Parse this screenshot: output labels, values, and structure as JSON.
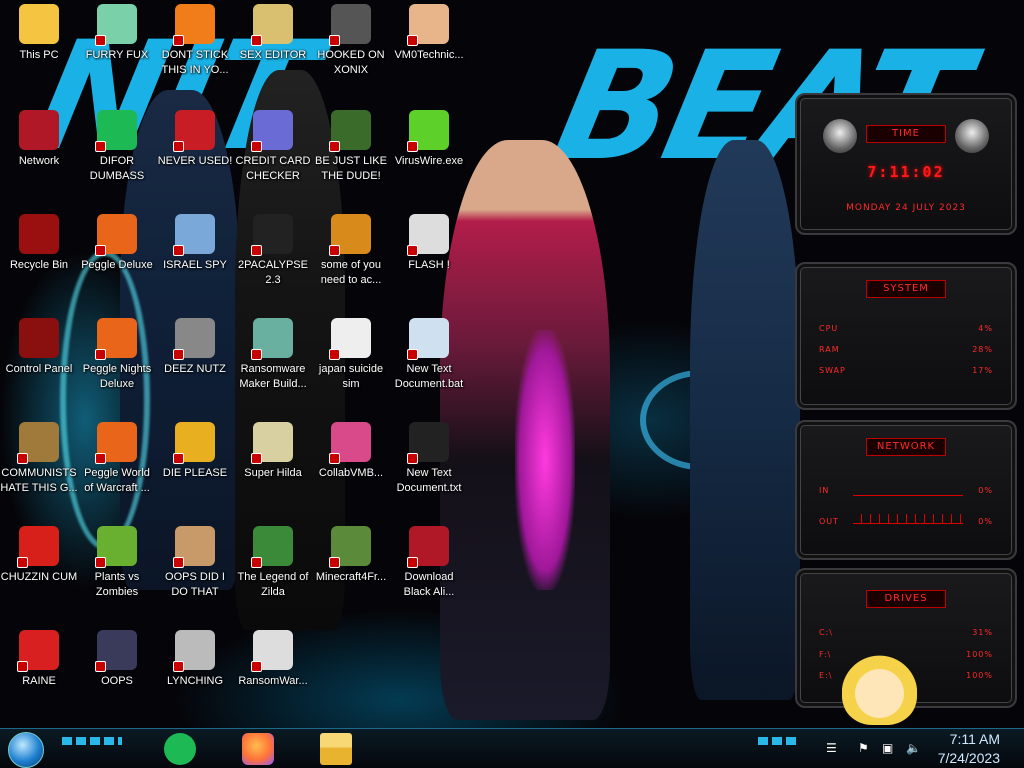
{
  "icons": [
    {
      "label": "This PC",
      "color": "#f5c542"
    },
    {
      "label": "FURRY FUX",
      "color": "#7ad0a8"
    },
    {
      "label": "DONT STICK THIS IN YO...",
      "color": "#f07d1a"
    },
    {
      "label": "SEX EDITOR",
      "color": "#d8c070"
    },
    {
      "label": "HOOKED ON XONIX",
      "color": "#555"
    },
    {
      "label": "VM0Technic...",
      "color": "#e8b48a"
    },
    {
      "label": "Network",
      "color": "#b01828"
    },
    {
      "label": "DIFOR DUMBASS",
      "color": "#1db954"
    },
    {
      "label": "NEVER USED!",
      "color": "#c81d25"
    },
    {
      "label": "CREDIT CARD CHECKER",
      "color": "#6b6bd6"
    },
    {
      "label": "BE JUST LIKE THE DUDE!",
      "color": "#3a6b2a"
    },
    {
      "label": "VirusWire.exe",
      "color": "#5ed02a"
    },
    {
      "label": "Recycle Bin",
      "color": "#9a1010"
    },
    {
      "label": "Peggle Deluxe",
      "color": "#e8651a"
    },
    {
      "label": "ISRAEL SPY",
      "color": "#7aa8d8"
    },
    {
      "label": "2PACALYPSE 2.3",
      "color": "#222"
    },
    {
      "label": "some of you need to ac...",
      "color": "#d88a1a"
    },
    {
      "label": "FLASH !",
      "color": "#ddd"
    },
    {
      "label": "Control Panel",
      "color": "#8a1010"
    },
    {
      "label": "Peggle Nights Deluxe",
      "color": "#e8651a"
    },
    {
      "label": "DEEZ NUTZ",
      "color": "#888"
    },
    {
      "label": "Ransomware Maker Build...",
      "color": "#6ab0a0"
    },
    {
      "label": "japan suicide sim",
      "color": "#eee"
    },
    {
      "label": "New Text Document.bat",
      "color": "#cfe0f0"
    },
    {
      "label": "COMMUNISTS HATE THIS G...",
      "color": "#a07a3a"
    },
    {
      "label": "Peggle World of Warcraft ...",
      "color": "#e8651a"
    },
    {
      "label": "DIE PLEASE",
      "color": "#e8b020"
    },
    {
      "label": "Super Hilda",
      "color": "#d8d0a0"
    },
    {
      "label": "CollabVMB...",
      "color": "#d84a8a"
    },
    {
      "label": "New Text Document.txt",
      "color": "#222"
    },
    {
      "label": "CHUZZIN CUM",
      "color": "#d8201a"
    },
    {
      "label": "Plants vs Zombies",
      "color": "#6ab030"
    },
    {
      "label": "OOPS DID I DO THAT",
      "color": "#c89a6a"
    },
    {
      "label": "The Legend of Zilda",
      "color": "#3a8a3a"
    },
    {
      "label": "Minecraft4Fr...",
      "color": "#5a8a3a"
    },
    {
      "label": "Download Black Ali...",
      "color": "#b01828"
    },
    {
      "label": "RAINE",
      "color": "#d82020"
    },
    {
      "label": "OOPS",
      "color": "#3a3a5a"
    },
    {
      "label": "LYNCHING",
      "color": "#bbb"
    },
    {
      "label": "RansomWar...",
      "color": "#ddd"
    }
  ],
  "widgets": {
    "time": {
      "title": "TIME",
      "clock": "7:11:02",
      "date": "MONDAY 24 JULY 2023"
    },
    "system": {
      "title": "SYSTEM",
      "rows": [
        {
          "k": "CPU",
          "v": "4%"
        },
        {
          "k": "RAM",
          "v": "28%"
        },
        {
          "k": "SWAP",
          "v": "17%"
        }
      ]
    },
    "network": {
      "title": "NETWORK",
      "rows": [
        {
          "k": "IN",
          "v": "0%"
        },
        {
          "k": "OUT",
          "v": "0%"
        }
      ]
    },
    "drives": {
      "title": "DRIVES",
      "rows": [
        {
          "k": "C:\\",
          "v": "31%"
        },
        {
          "k": "F:\\",
          "v": "100%"
        },
        {
          "k": "E:\\",
          "v": "100%"
        }
      ]
    }
  },
  "taskbar": {
    "apps": [
      {
        "name": "Spotify",
        "color": "#1db954"
      },
      {
        "name": "Firefox",
        "color": "#ff7139"
      },
      {
        "name": "File Explorer",
        "color": "#f5c542"
      }
    ],
    "time": "7:11 AM",
    "date": "7/24/2023"
  }
}
